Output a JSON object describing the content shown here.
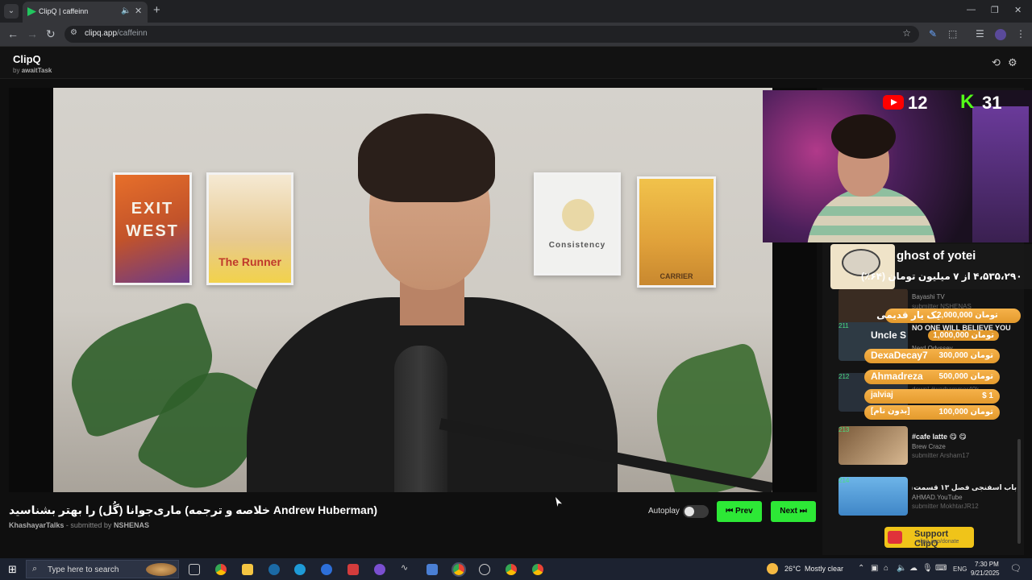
{
  "browser": {
    "tab_title": "ClipQ | caffeinn",
    "url_host": "clipq.app",
    "url_path": "/caffeinn"
  },
  "app": {
    "name": "ClipQ",
    "by_prefix": "by",
    "by_name": "awaitTask"
  },
  "poster_texts": {
    "p1": "EXIT WEST",
    "p2": "The Runner",
    "p3": "Consistency",
    "p4": "CARRIER"
  },
  "webcam": {
    "youtube_count": "12",
    "kick_badge": "K",
    "kick_count": "31"
  },
  "queue": [
    {
      "num": "",
      "title": "",
      "channel": "Bayashi TV",
      "submitter": "submitter NSHENAS"
    },
    {
      "num": "211",
      "title": "NO ONE WILL BELIEVE YOU",
      "channel": "Nerd Odyssey",
      "submitter": ""
    },
    {
      "num": "212",
      "title": "",
      "channel": "",
      "submitter": "down! #warhammer40k"
    },
    {
      "num": "213",
      "title": "#cafe latte 😋 😋",
      "channel": "Brew Craze",
      "submitter": "submitter Arsham17"
    },
    {
      "num": "214",
      "title": "باب اسفنجی فصل ۱۳ قسمت۱",
      "channel": "AHMAD.YouTube",
      "submitter": "submitter MokhtarJR12"
    }
  ],
  "donation_alert": {
    "name": "ghost of yotei",
    "progress": "۴،۵۳۵،۲۹۰ از ۷ میلیون تومان (۶۴٪)"
  },
  "donations": [
    {
      "name": "یک یار قدیمی",
      "amount": "2,000,000 تومان"
    },
    {
      "name": "Uncle S",
      "amount": "1,000,000 تومان"
    },
    {
      "name": "DexaDecay7",
      "amount": "300,000 تومان"
    },
    {
      "name": "Ahmadreza",
      "amount": "500,000 تومان"
    },
    {
      "name": "jalviaj",
      "amount": "$ 1"
    },
    {
      "name": "[بدون نام]",
      "amount": "100,000 تومان"
    }
  ],
  "support": {
    "label": "Support ClipQ",
    "sub": "clipq.app/donate"
  },
  "video": {
    "title": "خلاصه و ترجمه) ماری‌جوانا (گُل) را بهتر بشناسید Andrew Huberman)",
    "channel": "KhashayarTalks",
    "submitted_prefix": "- submitted by",
    "submitter": "NSHENAS",
    "autoplay_label": "Autoplay",
    "autoplay_on": false,
    "prev_label": "⏮ Prev",
    "next_label": "Next ⏭"
  },
  "taskbar": {
    "search_placeholder": "Type here to search",
    "temp": "26°C",
    "weather": "Mostly clear",
    "lang": "ENG",
    "time": "7:30 PM",
    "date": "9/21/2025"
  },
  "colors": {
    "accent_green": "#2de836",
    "kick_green": "#53fc18",
    "youtube_red": "#ff0000",
    "donation_orange": "#e39a2d",
    "support_yellow": "#f0c419"
  }
}
